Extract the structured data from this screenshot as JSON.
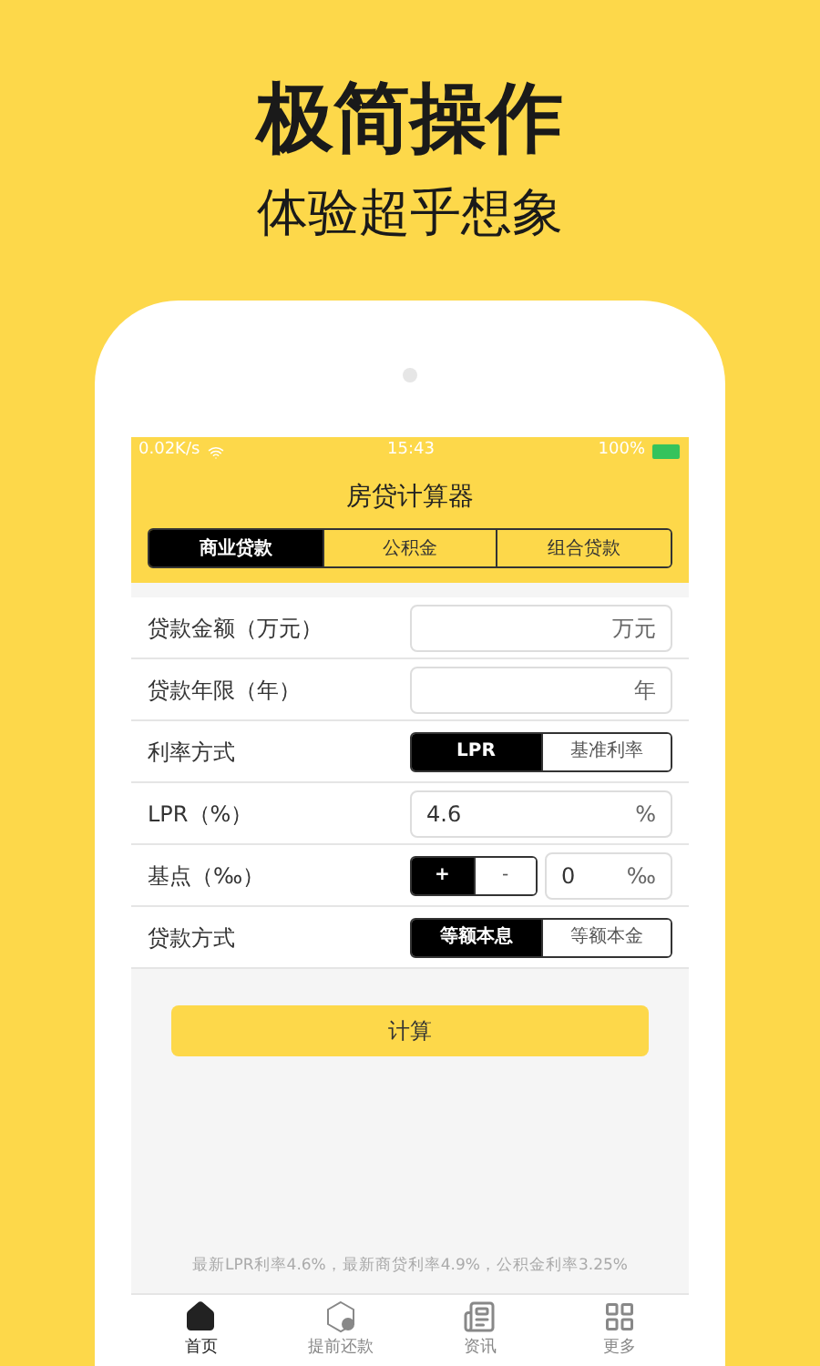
{
  "headline": "极简操作",
  "subheadline": "体验超乎想象",
  "status_bar": {
    "network": "0.02K/s",
    "time": "15:43",
    "battery": "100%"
  },
  "app_title": "房贷计算器",
  "tabs": [
    {
      "label": "商业贷款",
      "selected": true
    },
    {
      "label": "公积金",
      "selected": false
    },
    {
      "label": "组合贷款",
      "selected": false
    }
  ],
  "form": [
    {
      "kind": "input",
      "label": "贷款金额（万元）",
      "unit": "万元"
    },
    {
      "kind": "input",
      "label": "贷款年限（年）",
      "unit": "年"
    },
    {
      "kind": "segmented",
      "label": "利率方式",
      "options": [
        {
          "label": "LPR",
          "selected": true
        },
        {
          "label": "基准利率",
          "selected": false
        }
      ]
    },
    {
      "kind": "input",
      "label": "LPR（%）",
      "value": "4.6",
      "unit": "%"
    },
    {
      "kind": "stepper",
      "label": "基点（‰）",
      "options": [
        {
          "label": "+",
          "selected": true
        },
        {
          "label": "-",
          "selected": false
        }
      ],
      "value": "0",
      "unit": "‰"
    },
    {
      "kind": "segmented",
      "label": "贷款方式",
      "options": [
        {
          "label": "等额本息",
          "selected": true
        },
        {
          "label": "等额本金",
          "selected": false
        }
      ]
    }
  ],
  "calculate_button": "计算",
  "footer_note": "最新LPR利率4.6%，最新商贷利率4.9%，公积金利率3.25%",
  "bottom_nav": [
    {
      "kind": "home",
      "label": "首页",
      "selected": true
    },
    {
      "kind": "prepay",
      "label": "提前还款",
      "selected": false
    },
    {
      "kind": "news",
      "label": "资讯",
      "selected": false
    },
    {
      "kind": "more",
      "label": "更多",
      "selected": false
    }
  ]
}
